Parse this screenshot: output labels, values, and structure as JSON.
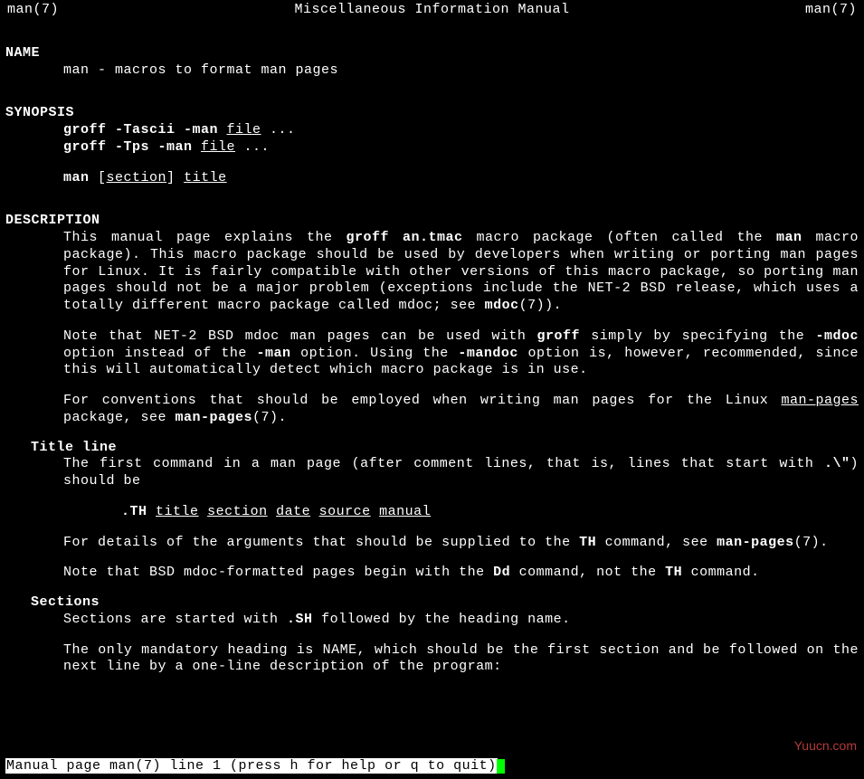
{
  "header": {
    "left": "man(7)",
    "center": "Miscellaneous Information Manual",
    "right": "man(7)"
  },
  "sections": {
    "name": {
      "heading": "NAME",
      "line": "man - macros to format man pages"
    },
    "synopsis": {
      "heading": "SYNOPSIS",
      "line1_cmd": "groff -Tascii -man ",
      "line1_file": "file",
      "line1_rest": " ...",
      "line2_cmd": "groff -Tps -man ",
      "line2_file": "file",
      "line2_rest": " ...",
      "line3_cmd": "man",
      "line3_sp1": " [",
      "line3_section": "section",
      "line3_sp2": "] ",
      "line3_title": "title"
    },
    "description": {
      "heading": "DESCRIPTION",
      "p1a": "This manual page explains the ",
      "p1_groff": "groff an.tmac",
      "p1b": " macro package (often called the ",
      "p1_man": "man",
      "p1c": " macro package).  This macro package should be used by developers when  writing  or  porting man pages for Linux.  It is fairly compatible with other versions of this macro package, so porting man pages should not be a major problem (exceptions include the NET-2 BSD release, which uses a totally different macro package called mdoc; see ",
      "p1_mdoc": "mdoc",
      "p1d": "(7)).",
      "p2a": "Note  that  NET-2  BSD mdoc man pages can be used with ",
      "p2_groff": "groff",
      "p2b": " simply by specifying the ",
      "p2_mdoc_opt": "-mdoc",
      "p2c": " option instead of the ",
      "p2_man_opt": "-man",
      "p2d": " option.  Using the ",
      "p2_mandoc_opt": "-mandoc",
      "p2e": " option is, however,  recommended, since this will automatically detect which macro package is in use.",
      "p3a": "For  conventions  that  should  be employed when writing man pages for the Linux ",
      "p3_manpages": "man-pages",
      "p3b": " package, see ",
      "p3_ref": "man-pages",
      "p3c": "(7)."
    },
    "titleline": {
      "heading": "Title line",
      "p1a": "The first command in a man page (after comment lines, that is, lines that start  with ",
      "p1_esc": ".\\\"",
      "p1b": ") should be",
      "th_cmd": ".TH",
      "th_title": "title",
      "th_section": "section",
      "th_date": "date",
      "th_source": "source",
      "th_manual": "manual",
      "p2a": "For  details  of  the  arguments  that  should  be  supplied  to  the ",
      "p2_th": "TH",
      "p2b": " command, see ",
      "p2_ref": "man-pages",
      "p2c": "(7).",
      "p3a": "Note that BSD mdoc-formatted pages begin with the ",
      "p3_dd": "Dd",
      "p3b": " command, not the ",
      "p3_th": "TH",
      "p3c": " command."
    },
    "sections_sub": {
      "heading": "Sections",
      "p1a": "Sections are started with ",
      "p1_sh": ".SH",
      "p1b": " followed by the heading name.",
      "p2": "The only mandatory heading is NAME, which should be the first section and be followed on the next line by a one-line description of the program:"
    }
  },
  "status": "Manual page man(7) line 1 (press h for help or q to quit)",
  "watermark": "Yuucn.com"
}
